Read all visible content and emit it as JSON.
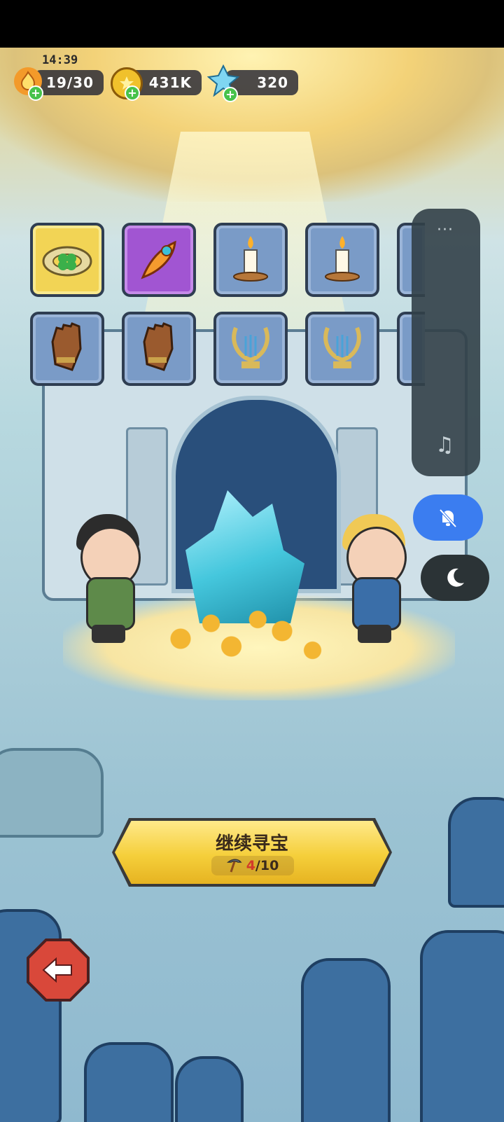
{
  "status_bar": {
    "time": "14:39"
  },
  "resources": [
    {
      "name": "energy",
      "value": "19/30",
      "icon": "flame-icon"
    },
    {
      "name": "coins",
      "value": "431K",
      "icon": "coin-icon"
    },
    {
      "name": "gems",
      "value": "320",
      "icon": "crystal-icon"
    }
  ],
  "items": [
    {
      "name": "clover-ring",
      "rarity": "gold",
      "icon": "clover-ring-icon"
    },
    {
      "name": "phoenix-feather",
      "rarity": "purple",
      "icon": "feather-icon"
    },
    {
      "name": "candle",
      "rarity": "blue",
      "icon": "candle-icon"
    },
    {
      "name": "candle",
      "rarity": "blue",
      "icon": "candle-icon"
    },
    {
      "name": "leather-glove",
      "rarity": "blue",
      "icon": "glove-icon"
    },
    {
      "name": "leather-glove",
      "rarity": "blue",
      "icon": "glove-icon"
    },
    {
      "name": "lyre",
      "rarity": "blue",
      "icon": "lyre-icon"
    },
    {
      "name": "lyre",
      "rarity": "blue",
      "icon": "lyre-icon"
    }
  ],
  "continue_button": {
    "label": "继续寻宝",
    "pickaxe_current": "4",
    "pickaxe_total": "/10"
  },
  "floating_panel": {
    "dots": "···",
    "music_icon": "♫"
  },
  "colors": {
    "gold_slot": "#f2d455",
    "purple_slot": "#a155d2",
    "blue_slot": "#7a9bc7",
    "bell_button": "#3b7df0",
    "button_yellow": "#f5cf3b"
  }
}
